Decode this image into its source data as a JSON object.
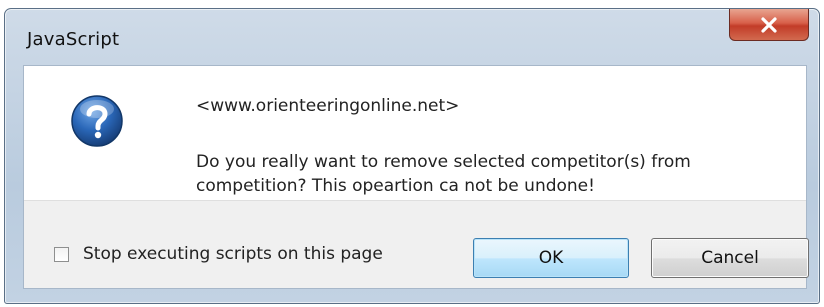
{
  "dialog": {
    "title": "JavaScript",
    "close_label": "X"
  },
  "message": {
    "origin": "<www.orienteeringonline.net>",
    "body": "Do you really want to remove selected competitor(s) from competition? This opeartion ca not be undone!"
  },
  "options": {
    "stop_scripts_label": "Stop executing scripts on this page",
    "stop_scripts_checked": false
  },
  "buttons": {
    "ok_label": "OK",
    "cancel_label": "Cancel"
  },
  "icons": {
    "dialog_icon": "question-icon",
    "close_icon": "close-icon"
  },
  "colors": {
    "close_button": "#c23c28",
    "question_icon": "#1f5fb0",
    "ok_border": "#3c7fb1"
  }
}
